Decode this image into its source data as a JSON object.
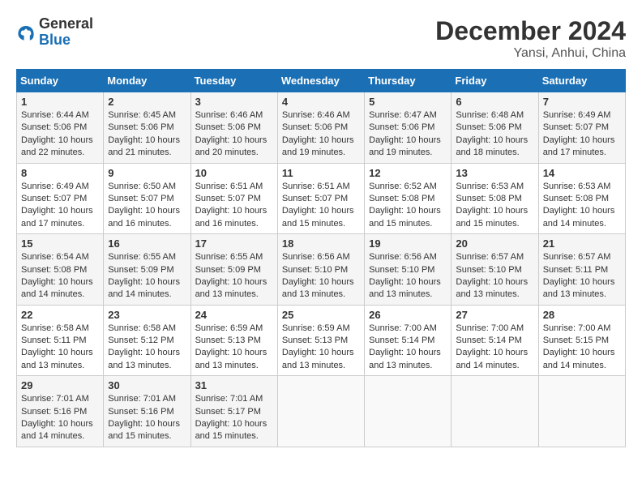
{
  "logo": {
    "general": "General",
    "blue": "Blue"
  },
  "title": "December 2024",
  "subtitle": "Yansi, Anhui, China",
  "days_of_week": [
    "Sunday",
    "Monday",
    "Tuesday",
    "Wednesday",
    "Thursday",
    "Friday",
    "Saturday"
  ],
  "weeks": [
    [
      {
        "day": "1",
        "sunrise": "6:44 AM",
        "sunset": "5:06 PM",
        "daylight": "10 hours and 22 minutes."
      },
      {
        "day": "2",
        "sunrise": "6:45 AM",
        "sunset": "5:06 PM",
        "daylight": "10 hours and 21 minutes."
      },
      {
        "day": "3",
        "sunrise": "6:46 AM",
        "sunset": "5:06 PM",
        "daylight": "10 hours and 20 minutes."
      },
      {
        "day": "4",
        "sunrise": "6:46 AM",
        "sunset": "5:06 PM",
        "daylight": "10 hours and 19 minutes."
      },
      {
        "day": "5",
        "sunrise": "6:47 AM",
        "sunset": "5:06 PM",
        "daylight": "10 hours and 19 minutes."
      },
      {
        "day": "6",
        "sunrise": "6:48 AM",
        "sunset": "5:06 PM",
        "daylight": "10 hours and 18 minutes."
      },
      {
        "day": "7",
        "sunrise": "6:49 AM",
        "sunset": "5:07 PM",
        "daylight": "10 hours and 17 minutes."
      }
    ],
    [
      {
        "day": "8",
        "sunrise": "6:49 AM",
        "sunset": "5:07 PM",
        "daylight": "10 hours and 17 minutes."
      },
      {
        "day": "9",
        "sunrise": "6:50 AM",
        "sunset": "5:07 PM",
        "daylight": "10 hours and 16 minutes."
      },
      {
        "day": "10",
        "sunrise": "6:51 AM",
        "sunset": "5:07 PM",
        "daylight": "10 hours and 16 minutes."
      },
      {
        "day": "11",
        "sunrise": "6:51 AM",
        "sunset": "5:07 PM",
        "daylight": "10 hours and 15 minutes."
      },
      {
        "day": "12",
        "sunrise": "6:52 AM",
        "sunset": "5:08 PM",
        "daylight": "10 hours and 15 minutes."
      },
      {
        "day": "13",
        "sunrise": "6:53 AM",
        "sunset": "5:08 PM",
        "daylight": "10 hours and 15 minutes."
      },
      {
        "day": "14",
        "sunrise": "6:53 AM",
        "sunset": "5:08 PM",
        "daylight": "10 hours and 14 minutes."
      }
    ],
    [
      {
        "day": "15",
        "sunrise": "6:54 AM",
        "sunset": "5:08 PM",
        "daylight": "10 hours and 14 minutes."
      },
      {
        "day": "16",
        "sunrise": "6:55 AM",
        "sunset": "5:09 PM",
        "daylight": "10 hours and 14 minutes."
      },
      {
        "day": "17",
        "sunrise": "6:55 AM",
        "sunset": "5:09 PM",
        "daylight": "10 hours and 13 minutes."
      },
      {
        "day": "18",
        "sunrise": "6:56 AM",
        "sunset": "5:10 PM",
        "daylight": "10 hours and 13 minutes."
      },
      {
        "day": "19",
        "sunrise": "6:56 AM",
        "sunset": "5:10 PM",
        "daylight": "10 hours and 13 minutes."
      },
      {
        "day": "20",
        "sunrise": "6:57 AM",
        "sunset": "5:10 PM",
        "daylight": "10 hours and 13 minutes."
      },
      {
        "day": "21",
        "sunrise": "6:57 AM",
        "sunset": "5:11 PM",
        "daylight": "10 hours and 13 minutes."
      }
    ],
    [
      {
        "day": "22",
        "sunrise": "6:58 AM",
        "sunset": "5:11 PM",
        "daylight": "10 hours and 13 minutes."
      },
      {
        "day": "23",
        "sunrise": "6:58 AM",
        "sunset": "5:12 PM",
        "daylight": "10 hours and 13 minutes."
      },
      {
        "day": "24",
        "sunrise": "6:59 AM",
        "sunset": "5:13 PM",
        "daylight": "10 hours and 13 minutes."
      },
      {
        "day": "25",
        "sunrise": "6:59 AM",
        "sunset": "5:13 PM",
        "daylight": "10 hours and 13 minutes."
      },
      {
        "day": "26",
        "sunrise": "7:00 AM",
        "sunset": "5:14 PM",
        "daylight": "10 hours and 13 minutes."
      },
      {
        "day": "27",
        "sunrise": "7:00 AM",
        "sunset": "5:14 PM",
        "daylight": "10 hours and 14 minutes."
      },
      {
        "day": "28",
        "sunrise": "7:00 AM",
        "sunset": "5:15 PM",
        "daylight": "10 hours and 14 minutes."
      }
    ],
    [
      {
        "day": "29",
        "sunrise": "7:01 AM",
        "sunset": "5:16 PM",
        "daylight": "10 hours and 14 minutes."
      },
      {
        "day": "30",
        "sunrise": "7:01 AM",
        "sunset": "5:16 PM",
        "daylight": "10 hours and 15 minutes."
      },
      {
        "day": "31",
        "sunrise": "7:01 AM",
        "sunset": "5:17 PM",
        "daylight": "10 hours and 15 minutes."
      },
      null,
      null,
      null,
      null
    ]
  ]
}
